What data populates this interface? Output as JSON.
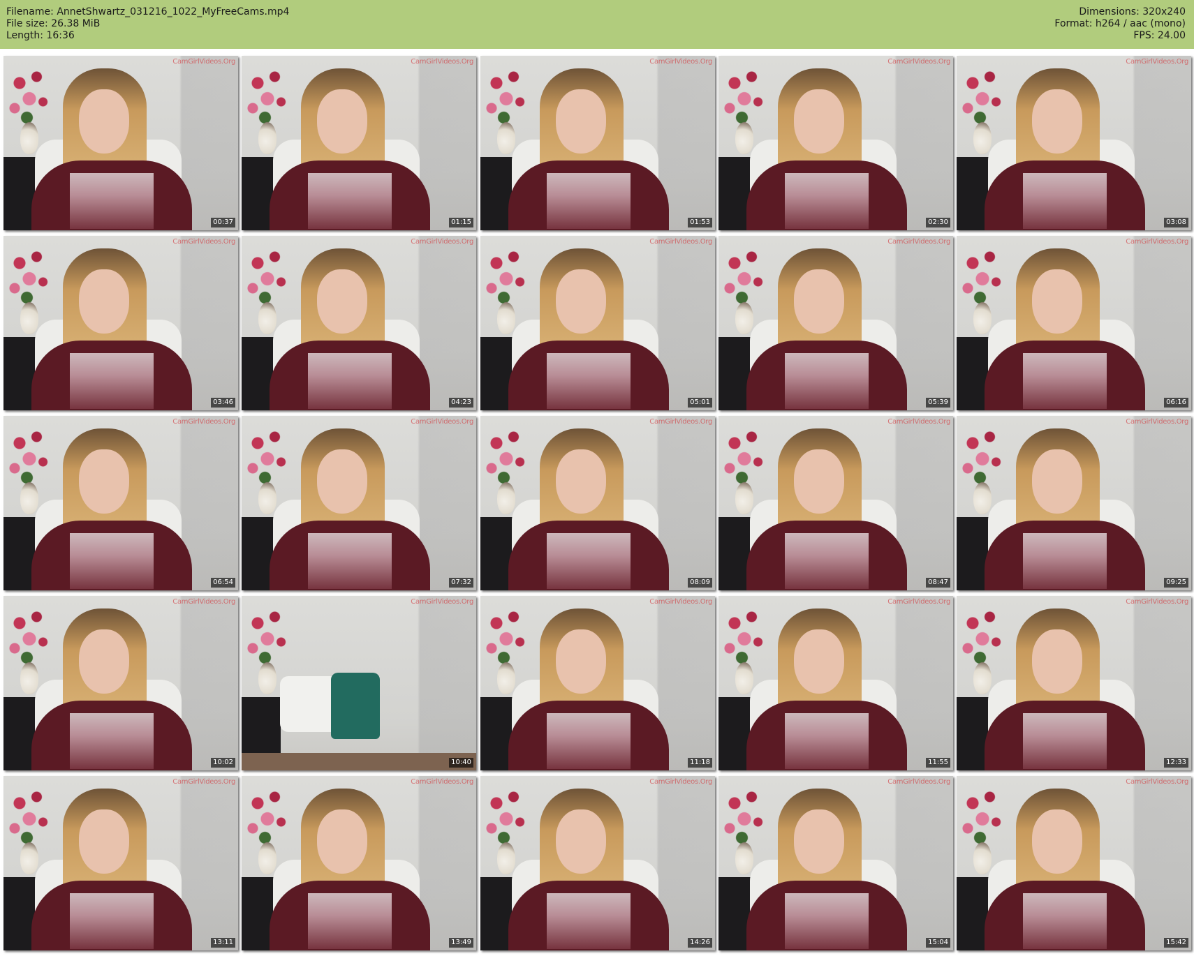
{
  "header": {
    "background": "#b1cc7d",
    "left": [
      {
        "label": "Filename:",
        "value": "AnnetShwartz_031216_1022_MyFreeCams.mp4"
      },
      {
        "label": "File size:",
        "value": "26.38 MiB"
      },
      {
        "label": "Length:",
        "value": "16:36"
      }
    ],
    "right": [
      {
        "label": "Dimensions:",
        "value": "320x240"
      },
      {
        "label": "Format:",
        "value": "h264 / aac (mono)"
      },
      {
        "label": "FPS:",
        "value": "24.00"
      }
    ]
  },
  "watermark_text": "CamGirlVideos.Org",
  "thumbnails": [
    {
      "timestamp": "00:37"
    },
    {
      "timestamp": "01:15"
    },
    {
      "timestamp": "01:53"
    },
    {
      "timestamp": "02:30"
    },
    {
      "timestamp": "03:08"
    },
    {
      "timestamp": "03:46"
    },
    {
      "timestamp": "04:23"
    },
    {
      "timestamp": "05:01"
    },
    {
      "timestamp": "05:39"
    },
    {
      "timestamp": "06:16"
    },
    {
      "timestamp": "06:54"
    },
    {
      "timestamp": "07:32"
    },
    {
      "timestamp": "08:09"
    },
    {
      "timestamp": "08:47"
    },
    {
      "timestamp": "09:25"
    },
    {
      "timestamp": "10:02"
    },
    {
      "timestamp": "10:40",
      "scene": "empty"
    },
    {
      "timestamp": "11:18"
    },
    {
      "timestamp": "11:55"
    },
    {
      "timestamp": "12:33"
    },
    {
      "timestamp": "13:11"
    },
    {
      "timestamp": "13:49"
    },
    {
      "timestamp": "14:26"
    },
    {
      "timestamp": "15:04"
    },
    {
      "timestamp": "15:42"
    }
  ]
}
